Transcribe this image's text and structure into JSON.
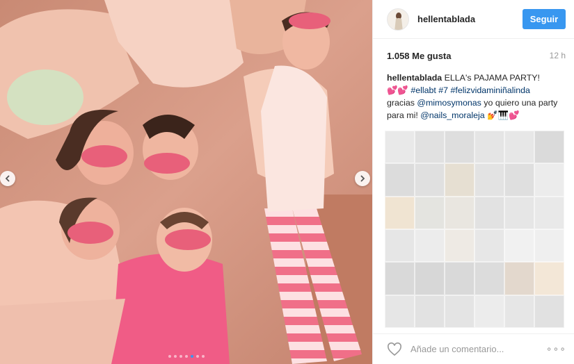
{
  "post": {
    "username": "hellentablada",
    "follow_label": "Seguir",
    "likes": "1.058 Me gusta",
    "time": "12 h",
    "caption": {
      "user": "hellentablada",
      "line1": "ELLA's PAJAMA PARTY!",
      "hearts_a": "💕💕",
      "tag1": "#ellabt",
      "tag2": "#7",
      "tag3": "#felizvidaminiñalinda",
      "line3a": "gracias ",
      "mention1": "@mimosymonas",
      "line3b": " yo quiero una party para mi! ",
      "mention2": "@nails_moraleja",
      "hearts_b": "💅🎹💕"
    },
    "comment_placeholder": "Añade un comentario...",
    "more_label": "∘∘∘"
  },
  "carousel": {
    "slide_count": 7,
    "active_index": 4
  },
  "colors": {
    "accent": "#3897f0",
    "photo_base": "#d8a090",
    "robe": "#f2c3b0",
    "eye_mask": "#e8607a",
    "stripe": "#e8607a"
  },
  "icons": {
    "prev": "chevron-left-icon",
    "next": "chevron-right-icon",
    "like": "heart-outline-icon",
    "more": "more-options-icon"
  },
  "blurred_tiles": [
    "#e9e9e9",
    "#e1e1e1",
    "#dedede",
    "#e5e5e5",
    "#e7e7e7",
    "#dadada",
    "#dcdcdc",
    "#e0e0e0",
    "#e6dfd2",
    "#e3e3e3",
    "#dfdfdf",
    "#ececec",
    "#f0e4d2",
    "#e4e4e0",
    "#e9e6e0",
    "#e2e2e2",
    "#e6e6e6",
    "#e9e9e9",
    "#e6e6e6",
    "#ececec",
    "#eeeae4",
    "#e7e7e7",
    "#f1f1f1",
    "#efefef",
    "#d9d9d9",
    "#d7d7d7",
    "#d9d9d9",
    "#dcdcdc",
    "#e3d8cd",
    "#f3e7d7",
    "#e6e6e6",
    "#e2e2e2",
    "#e4e4e4",
    "#ececec",
    "#e6e6e6",
    "#e1e1e1"
  ]
}
